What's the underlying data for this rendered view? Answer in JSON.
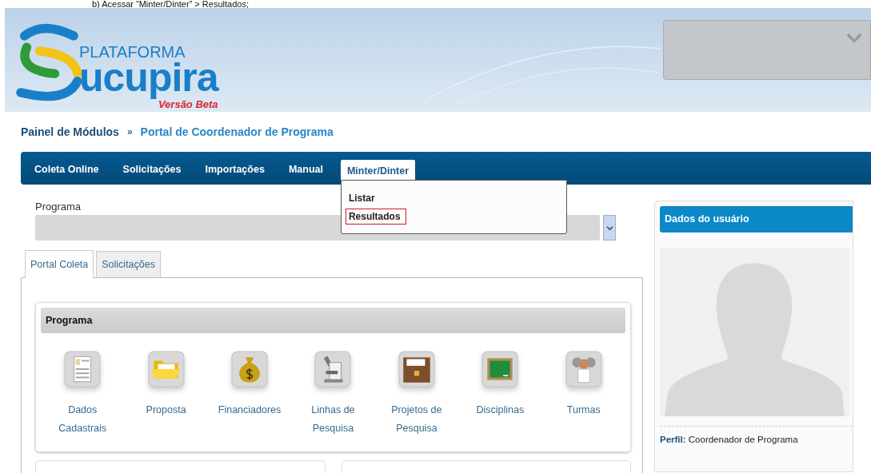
{
  "caption": "b) Acessar “Minter/Dinter” > Resultados;",
  "header": {
    "logo_top": "PLATAFORMA",
    "logo_word": "ucupira",
    "logo_tag": "Versão Beta"
  },
  "breadcrumb": {
    "root": "Painel de Módulos",
    "separator": "»",
    "current": "Portal de Coordenador de Programa"
  },
  "nav": [
    {
      "label": "Coleta Online",
      "selected": false
    },
    {
      "label": "Solicitações",
      "selected": false
    },
    {
      "label": "Importações",
      "selected": false
    },
    {
      "label": "Manual",
      "selected": false
    },
    {
      "label": "Minter/Dinter",
      "selected": true
    }
  ],
  "dropdown": [
    {
      "label": "Listar",
      "highlighted": false
    },
    {
      "label": "Resultados",
      "highlighted": true
    }
  ],
  "program_field": {
    "label": "Programa"
  },
  "tabs": [
    {
      "label": "Portal Coleta",
      "selected": true
    },
    {
      "label": "Solicitações",
      "selected": false
    }
  ],
  "module_card": {
    "title": "Programa",
    "modules": [
      {
        "label": "Dados Cadastrais",
        "kind": "form"
      },
      {
        "label": "Proposta",
        "kind": "folder"
      },
      {
        "label": "Financiadores",
        "kind": "money"
      },
      {
        "label": "Linhas de Pesquisa",
        "kind": "microscope"
      },
      {
        "label": "Projetos de Pesquisa",
        "kind": "archive"
      },
      {
        "label": "Disciplinas",
        "kind": "board"
      },
      {
        "label": "Turmas",
        "kind": "people"
      }
    ]
  },
  "user_panel": {
    "title": "Dados do usuário",
    "profile_label": "Perfil:",
    "profile_value": "Coordenador de Programa"
  }
}
